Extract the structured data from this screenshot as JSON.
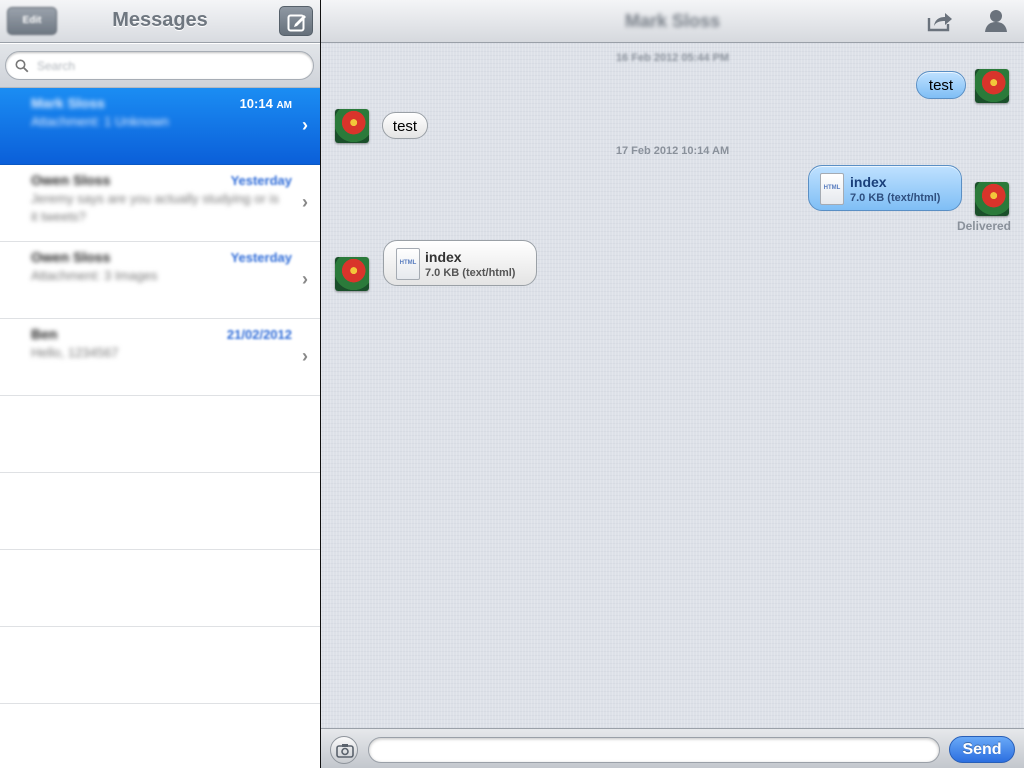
{
  "left_nav": {
    "title": "Messages",
    "edit_label": "Edit"
  },
  "search": {
    "placeholder": "Search"
  },
  "conversations": [
    {
      "name": "Mark Sloss",
      "time": "10:14",
      "ampm": "AM",
      "preview": "Attachment: 1 Unknown",
      "selected": true
    },
    {
      "name": "Owen Sloss",
      "time": "Yesterday",
      "preview": "Jeremy says are you actually studying or is it tweets?"
    },
    {
      "name": "Owen Sloss",
      "time": "Yesterday",
      "preview": "Attachment: 3 Images"
    },
    {
      "name": "Ben",
      "time": "21/02/2012",
      "preview": "Hello, 1234567"
    }
  ],
  "thread": {
    "contact_name": "Mark Sloss",
    "timestamp_1": "16 Feb 2012 05:44 PM",
    "out_text_1": "test",
    "in_text_1": "test",
    "timestamp_2": "17 Feb 2012 10:14 AM",
    "out_file": {
      "icon_label": "HTML",
      "name": "index",
      "size": "7.0 KB (text/html)"
    },
    "delivered": "Delivered",
    "in_file": {
      "icon_label": "HTML",
      "name": "index",
      "size": "7.0 KB (text/html)"
    }
  },
  "compose": {
    "send_label": "Send",
    "placeholder": ""
  },
  "icons": {
    "compose": "compose-icon",
    "search": "search-icon",
    "share": "share-icon",
    "contact": "contact-icon",
    "camera": "camera-icon",
    "chevron": "chevron-right-icon"
  },
  "colors": {
    "accent": "#0b63dc",
    "send": "#2c6fe0",
    "outgoing_bubble": "#9fd0fb"
  }
}
